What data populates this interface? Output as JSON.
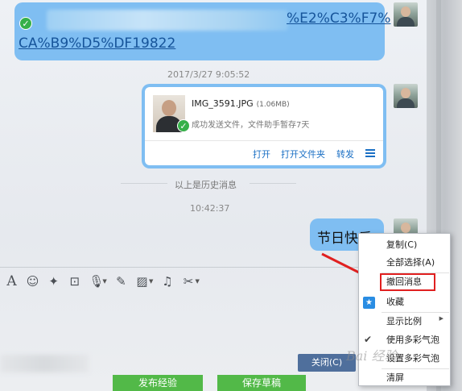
{
  "chat": {
    "link_message": {
      "line1": "%E2%C3%F7%",
      "line2": "CA%B9%D5%DF19822"
    },
    "timestamp_1": "2017/3/27 9:05:52",
    "file": {
      "name": "IMG_3591.JPG",
      "size": "(1.06MB)",
      "status": "成功发送文件，文件助手暂存7天",
      "actions": [
        "打开",
        "打开文件夹",
        "转发"
      ]
    },
    "history_divider": "以上是历史消息",
    "timestamp_2": "10:42:37",
    "holiday_message": "节日快乐"
  },
  "toolbar": {
    "icons": [
      "font-icon",
      "emoji-icon",
      "magic-icon",
      "screenshot-icon",
      "voice-icon",
      "edit-icon",
      "image-icon",
      "music-icon",
      "scissors-icon"
    ]
  },
  "bottom": {
    "close_button": "关闭(C)",
    "green_button_1": "发布经验",
    "green_button_2": "保存草稿"
  },
  "context_menu": {
    "items": [
      "复制(C)",
      "全部选择(A)",
      "撤回消息",
      "收藏",
      "显示比例",
      "使用多彩气泡",
      "设置多彩气泡",
      "清屏"
    ]
  },
  "watermark": "Bai 经验",
  "colors": {
    "bubble": "#7fbef2",
    "link": "#16549a",
    "action": "#1a6fc4",
    "highlight": "#e02020",
    "green": "#52b948"
  }
}
